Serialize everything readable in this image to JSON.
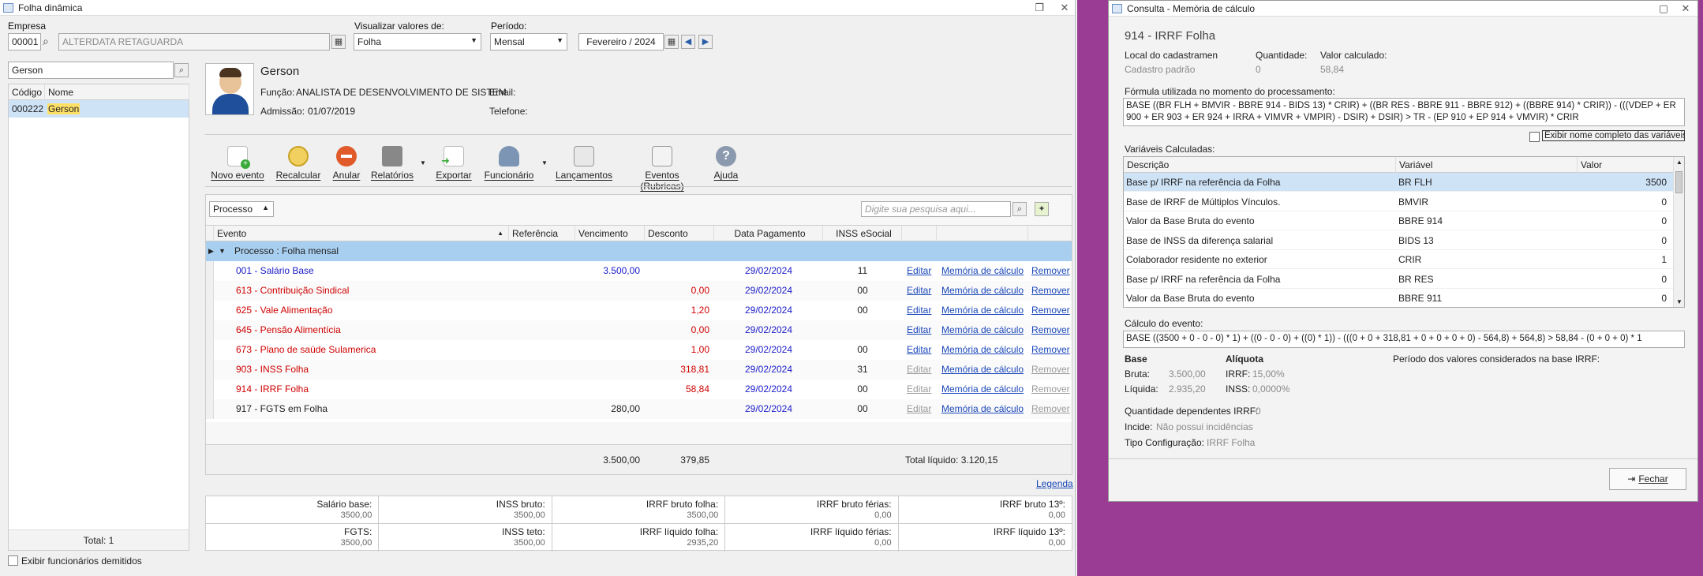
{
  "main": {
    "title": "Folha dinâmica",
    "empresa": {
      "label": "Empresa",
      "code": "00001",
      "name": "ALTERDATA RETAGUARDA"
    },
    "visualizar": {
      "label": "Visualizar valores de:",
      "value": "Folha"
    },
    "periodo": {
      "label": "Período:",
      "value": "Mensal",
      "date": "Fevereiro / 2024"
    },
    "search": {
      "value": "Gerson"
    },
    "employee_list": {
      "headers": [
        "Código",
        "Nome"
      ],
      "rows": [
        {
          "code": "000222",
          "name": "Gerson"
        }
      ],
      "total": "Total: 1"
    },
    "employee": {
      "name": "Gerson",
      "funcao_label": "Função:",
      "funcao": "ANALISTA DE DESENVOLVIMENTO DE SISTEM",
      "admissao_label": "Admissão:",
      "admissao": "01/07/2019",
      "email_label": "Email:",
      "telefone_label": "Telefone:"
    },
    "toolbar": {
      "novo": "Novo evento",
      "recalcular": "Recalcular",
      "anular": "Anular",
      "relatorios": "Relatórios",
      "exportar": "Exportar",
      "funcionario": "Funcionário",
      "lancamentos": "Lançamentos",
      "eventos": "Eventos (Rubricas)",
      "ajuda": "Ajuda"
    },
    "filter": {
      "value": "Processo",
      "search_placeholder": "Digite sua pesquisa aqui..."
    },
    "grid": {
      "headers": {
        "evento": "Evento",
        "referencia": "Referência",
        "vencimento": "Vencimento",
        "desconto": "Desconto",
        "data": "Data Pagamento",
        "inss": "INSS eSocial"
      },
      "group": "Processo : Folha mensal",
      "rows": [
        {
          "evento": "001 - Salário Base",
          "venc": "3.500,00",
          "desc": "",
          "data": "29/02/2024",
          "inss": "11",
          "edit": "Editar",
          "mem": "Memória de cálculo",
          "rem": "Remover"
        },
        {
          "evento": "613 - Contribuição Sindical",
          "venc": "",
          "desc": "0,00",
          "data": "29/02/2024",
          "inss": "00",
          "edit": "Editar",
          "mem": "Memória de cálculo",
          "rem": "Remover"
        },
        {
          "evento": "625 - Vale Alimentação",
          "venc": "",
          "desc": "1,20",
          "data": "29/02/2024",
          "inss": "00",
          "edit": "Editar",
          "mem": "Memória de cálculo",
          "rem": "Remover"
        },
        {
          "evento": "645 - Pensão Alimentícia",
          "venc": "",
          "desc": "0,00",
          "data": "29/02/2024",
          "inss": "",
          "edit": "Editar",
          "mem": "Memória de cálculo",
          "rem": "Remover"
        },
        {
          "evento": "673 - Plano de saúde Sulamerica",
          "venc": "",
          "desc": "1,00",
          "data": "29/02/2024",
          "inss": "00",
          "edit": "Editar",
          "mem": "Memória de cálculo",
          "rem": "Remover"
        },
        {
          "evento": "903 - INSS Folha",
          "venc": "",
          "desc": "318,81",
          "data": "29/02/2024",
          "inss": "31",
          "edit": "Editar",
          "mem": "Memória de cálculo",
          "rem": "Remover"
        },
        {
          "evento": "914 - IRRF Folha",
          "venc": "",
          "desc": "58,84",
          "data": "29/02/2024",
          "inss": "00",
          "edit": "Editar",
          "mem": "Memória de cálculo",
          "rem": "Remover"
        },
        {
          "evento": "917 - FGTS em Folha",
          "venc": "280,00",
          "desc": "",
          "data": "29/02/2024",
          "inss": "00",
          "edit": "Editar",
          "mem": "Memória de cálculo",
          "rem": "Remover"
        }
      ],
      "total_venc": "3.500,00",
      "total_desc": "379,85",
      "total_liquido": "Total líquido: 3.120,15"
    },
    "legenda": "Legenda",
    "summary": [
      {
        "label": "Salário base:",
        "value": "3500,00"
      },
      {
        "label": "INSS bruto:",
        "value": "3500,00"
      },
      {
        "label": "IRRF bruto folha:",
        "value": "3500,00"
      },
      {
        "label": "IRRF bruto férias:",
        "value": "0,00"
      },
      {
        "label": "IRRF bruto 13º:",
        "value": "0,00"
      },
      {
        "label": "FGTS:",
        "value": "3500,00"
      },
      {
        "label": "INSS teto:",
        "value": "3500,00"
      },
      {
        "label": "IRRF líquido folha:",
        "value": "2935,20"
      },
      {
        "label": "IRRF líquido férias:",
        "value": "0,00"
      },
      {
        "label": "IRRF líquido 13º:",
        "value": "0,00"
      }
    ],
    "exibir_demitidos": "Exibir funcionários demitidos"
  },
  "memoria": {
    "title": "Consulta - Memória de cálculo",
    "heading": "914 - IRRF Folha",
    "local_label": "Local do cadastramen",
    "local_value": "Cadastro padrão",
    "qtd_label": "Quantidade:",
    "qtd_value": "0",
    "valor_label": "Valor calculado:",
    "valor_value": "58,84",
    "formula_label": "Fórmula utilizada no momento do processamento:",
    "formula": "BASE ((BR FLH + BMVIR - BBRE 914 - BIDS 13) * CRIR) + ((BR RES - BBRE 911 - BBRE 912) + ((BBRE 914) * CRIR)) - (((VDEP + ER 900 + ER 903 + ER 924 + IRRA + VIMVR + VMPIR) - DSIR) + DSIR) > TR - (EP 910 + EP 914 + VMVIR) * CRIR",
    "exibir_nome": "Exibir nome completo das variáveis",
    "vars_label": "Variáveis Calculadas:",
    "vars_headers": [
      "Descrição",
      "Variável",
      "Valor"
    ],
    "vars": [
      {
        "d": "Base p/ IRRF na referência da Folha",
        "v": "BR FLH",
        "val": "3500"
      },
      {
        "d": "Base de IRRF de Múltiplos Vínculos.",
        "v": "BMVIR",
        "val": "0"
      },
      {
        "d": "Valor da Base Bruta do evento",
        "v": "BBRE 914",
        "val": "0"
      },
      {
        "d": "Base de INSS da diferença salarial",
        "v": "BIDS 13",
        "val": "0"
      },
      {
        "d": "Colaborador residente no exterior",
        "v": "CRIR",
        "val": "1"
      },
      {
        "d": "Base p/ IRRF na referência da Folha",
        "v": "BR RES",
        "val": "0"
      },
      {
        "d": "Valor da Base Bruta do evento",
        "v": "BBRE 911",
        "val": "0"
      }
    ],
    "calc_label": "Cálculo do evento:",
    "calc": "BASE ((3500 + 0 - 0 - 0) * 1) + ((0 - 0 - 0) + ((0) * 1)) - (((0 + 0 + 318,81 + 0 + 0 + 0 + 0) - 564,8) + 564,8) > 58,84 - (0 + 0 + 0) * 1",
    "base_label": "Base",
    "aliquota_label": "Alíquota",
    "bruta_label": "Bruta:",
    "bruta": "3.500,00",
    "irrf_label": "IRRF:",
    "irrf": "15,00%",
    "liquida_label": "Líquida:",
    "liquida": "2.935,20",
    "inss_label": "INSS:",
    "inss": "0,0000%",
    "periodo_label": "Período dos valores considerados na base IRRF:",
    "qtd_dep_label": "Quantidade dependentes IRRF:",
    "qtd_dep": "0",
    "incide_label": "Incide:",
    "incide": "Não possui incidências",
    "tipo_label": "Tipo Configuração:",
    "tipo": "IRRF Folha",
    "fechar": "Fechar"
  }
}
